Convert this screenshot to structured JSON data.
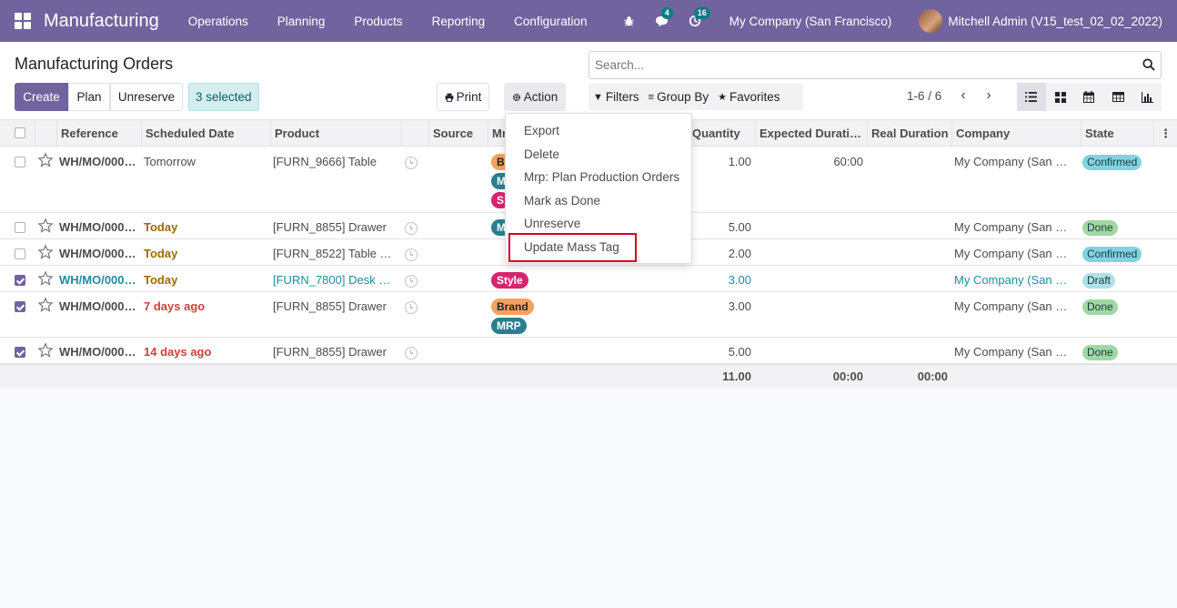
{
  "navbar": {
    "app_name": "Manufacturing",
    "menu": [
      "Operations",
      "Planning",
      "Products",
      "Reporting",
      "Configuration"
    ],
    "messages_count": "4",
    "activities_count": "16",
    "company": "My Company (San Francisco)",
    "user": "Mitchell Admin (V15_test_02_02_2022)",
    "brand_color": "#71639e"
  },
  "control": {
    "title": "Manufacturing Orders",
    "create_label": "Create",
    "plan_label": "Plan",
    "unreserve_label": "Unreserve",
    "selected_label": "3 selected",
    "print_label": "Print",
    "action_label": "Action",
    "search_placeholder": "Search...",
    "filters_label": "Filters",
    "groupby_label": "Group By",
    "favorites_label": "Favorites",
    "pager": "1-6 / 6",
    "views": [
      "list-icon",
      "kanban-icon",
      "calendar-icon",
      "pivot-icon",
      "graph-icon"
    ]
  },
  "action_menu": {
    "items": [
      "Export",
      "Delete",
      "Mrp: Plan Production Orders",
      "Mark as Done",
      "Unreserve",
      "Update Mass Tag"
    ],
    "highlighted": "Update Mass Tag"
  },
  "table": {
    "columns": [
      "Reference",
      "Scheduled Date",
      "Product",
      "Source",
      "Mr",
      "Quantity",
      "Expected Durati…",
      "Real Duration",
      "Company",
      "State"
    ],
    "rows": [
      {
        "checked": false,
        "reference": "WH/MO/000…",
        "date": "Tomorrow",
        "date_style": "normal",
        "product": "[FURN_9666] Table",
        "tags": [
          "B",
          "M",
          "S"
        ],
        "quantity": "1.00",
        "expected": "60:00",
        "real": "",
        "company": "My Company (San F…",
        "state": "Confirmed"
      },
      {
        "checked": false,
        "reference": "WH/MO/000…",
        "date": "Today",
        "date_style": "warning",
        "product": "[FURN_8855] Drawer",
        "tags": [
          "M"
        ],
        "quantity": "5.00",
        "expected": "",
        "real": "",
        "company": "My Company (San F…",
        "state": "Done"
      },
      {
        "checked": false,
        "reference": "WH/MO/000…",
        "date": "Today",
        "date_style": "warning",
        "product": "[FURN_8522] Table …",
        "tags": [],
        "quantity": "2.00",
        "expected": "",
        "real": "",
        "company": "My Company (San F…",
        "state": "Confirmed"
      },
      {
        "checked": true,
        "reference": "WH/MO/000…",
        "date": "Today",
        "date_style": "warning",
        "product": "[FURN_7800] Desk …",
        "tags": [
          "Style"
        ],
        "quantity": "3.00",
        "expected": "",
        "real": "",
        "company": "My Company (San F…",
        "state": "Draft",
        "info": true
      },
      {
        "checked": true,
        "reference": "WH/MO/000…",
        "date": "7 days ago",
        "date_style": "danger",
        "product": "[FURN_8855] Drawer",
        "tags": [
          "Brand",
          "MRP"
        ],
        "quantity": "3.00",
        "expected": "",
        "real": "",
        "company": "My Company (San F…",
        "state": "Done"
      },
      {
        "checked": true,
        "reference": "WH/MO/000…",
        "date": "14 days ago",
        "date_style": "danger",
        "product": "[FURN_8855] Drawer",
        "tags": [],
        "quantity": "5.00",
        "expected": "",
        "real": "",
        "company": "My Company (San F…",
        "state": "Done"
      }
    ],
    "totals": {
      "quantity": "11.00",
      "expected": "00:00",
      "real": "00:00"
    }
  },
  "colors": {
    "warning": "#9a6b01",
    "danger": "#d23f3a",
    "info": "#1f8ba3",
    "state_confirmed": "#7fd4e0",
    "state_done": "#9fd8a3",
    "state_draft": "#aee0ea",
    "tag_brand": "#f4a261",
    "tag_mrp": "#2a7f8f",
    "tag_style": "#d6246e"
  }
}
